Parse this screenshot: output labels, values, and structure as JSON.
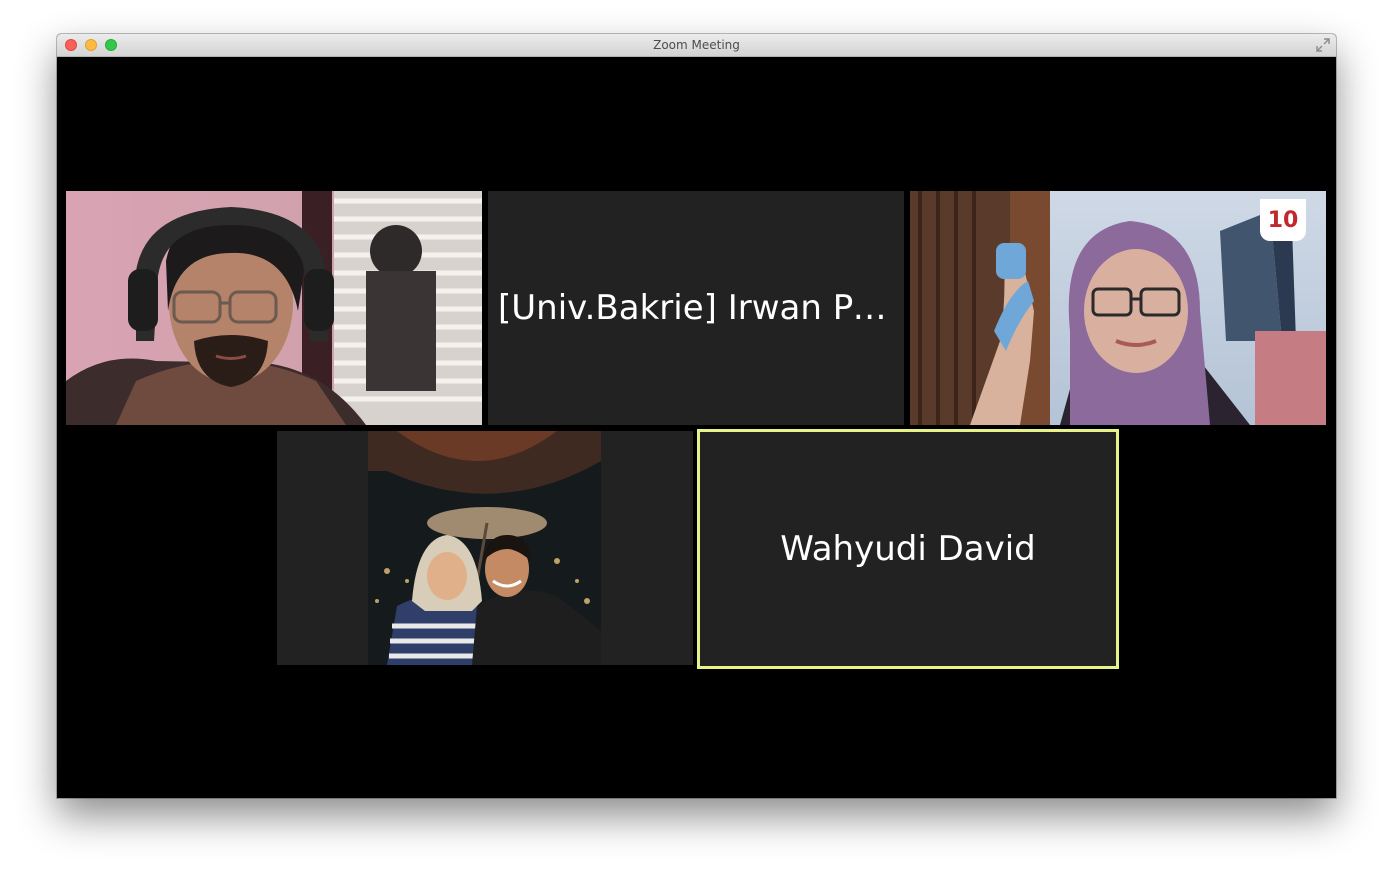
{
  "window": {
    "title": "Zoom Meeting"
  },
  "participants": [
    {
      "display": "video",
      "description": "man with glasses and headphones"
    },
    {
      "display": "name",
      "name": "[Univ.Bakrie] Irwan Pr…"
    },
    {
      "display": "video",
      "description": "woman in hijab with glasses",
      "logo_text": "10"
    },
    {
      "display": "video",
      "description": "couple selfie at night"
    },
    {
      "display": "name",
      "name": "Wahyudi David",
      "active_speaker": true
    }
  ],
  "colors": {
    "stage": "#000000",
    "tile": "#222222",
    "active_speaker_border": "#e8f28a",
    "label_text": "#ffffff"
  }
}
